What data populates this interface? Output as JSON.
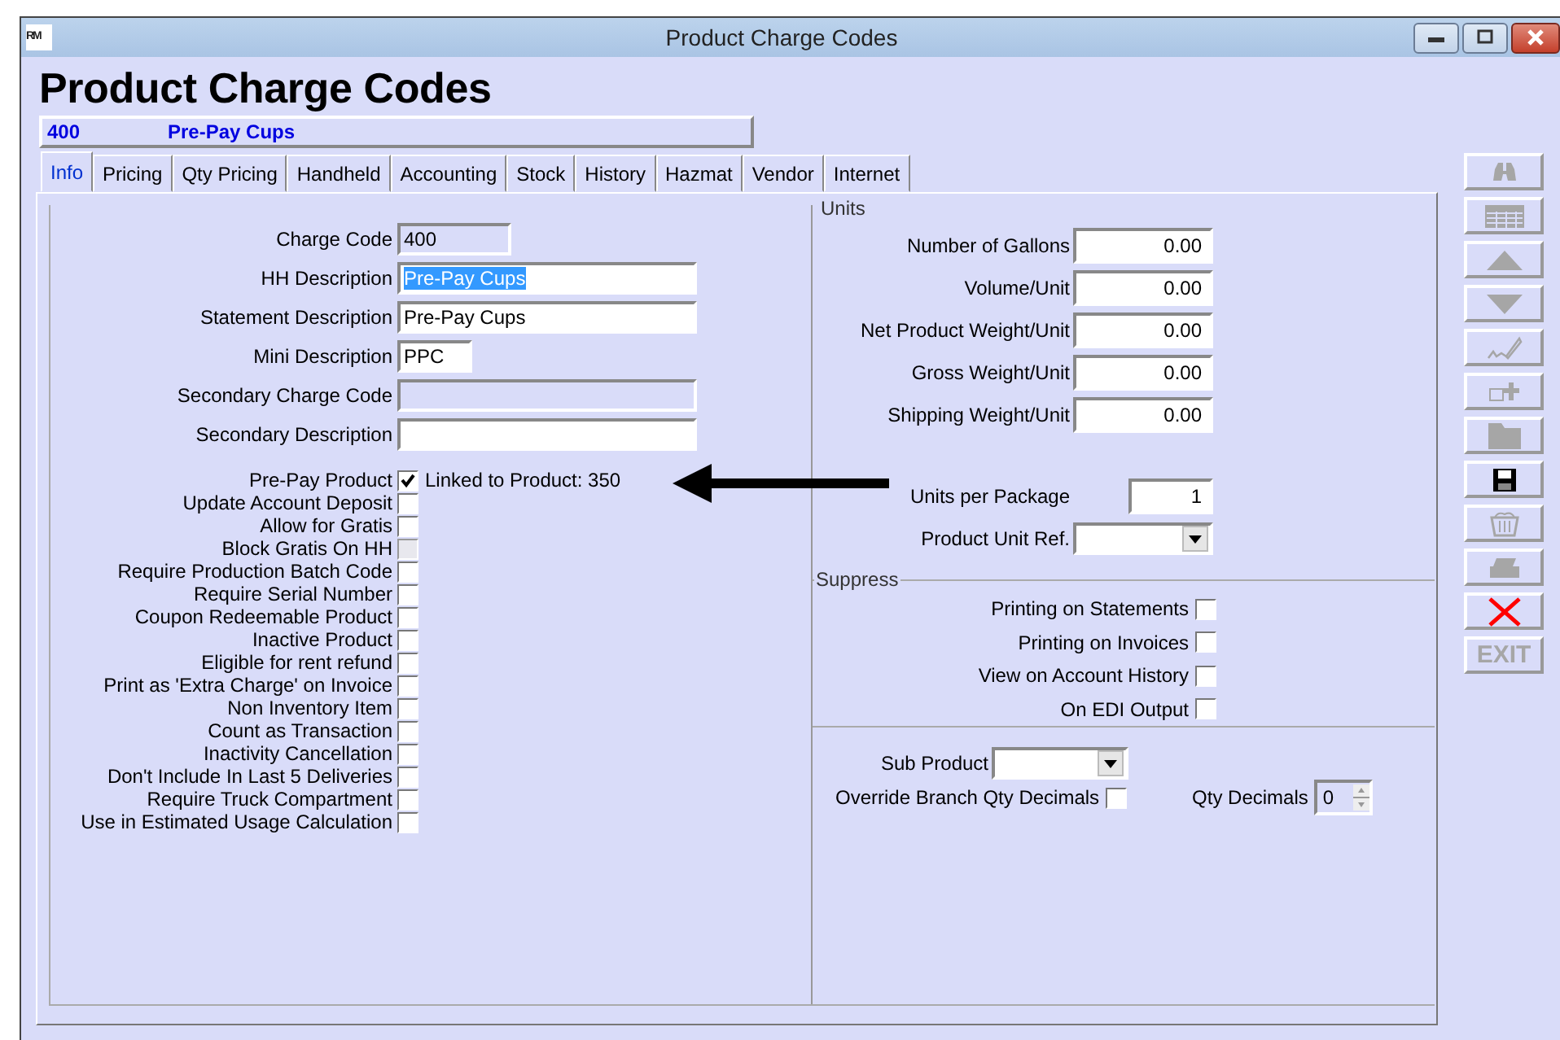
{
  "window": {
    "title": "Product Charge Codes",
    "logo": "RM"
  },
  "heading": "Product Charge Codes",
  "record": {
    "code": "400",
    "name": "Pre-Pay Cups"
  },
  "tabs": [
    {
      "label": "Info",
      "selected": true
    },
    {
      "label": "Pricing",
      "selected": false
    },
    {
      "label": "Qty Pricing",
      "selected": false
    },
    {
      "label": "Handheld",
      "selected": false
    },
    {
      "label": "Accounting",
      "selected": false
    },
    {
      "label": "Stock",
      "selected": false
    },
    {
      "label": "History",
      "selected": false
    },
    {
      "label": "Hazmat",
      "selected": false
    },
    {
      "label": "Vendor",
      "selected": false
    },
    {
      "label": "Internet",
      "selected": false
    }
  ],
  "fields": [
    {
      "label": "Charge Code",
      "value": "400",
      "disabled": true
    },
    {
      "label": "HH Description",
      "value": "Pre-Pay Cups",
      "disabled": false,
      "text_selected": true
    },
    {
      "label": "Statement Description",
      "value": "Pre-Pay Cups",
      "disabled": false
    },
    {
      "label": "Mini Description",
      "value": "PPC",
      "disabled": false
    },
    {
      "label": "Secondary Charge Code",
      "disabled": true
    },
    {
      "label": "Secondary Description",
      "disabled": false
    }
  ],
  "flags": [
    {
      "label": "Pre-Pay Product",
      "checked": true,
      "disabled": false,
      "note": "Linked to Product:  350"
    },
    {
      "label": "Update Account Deposit",
      "checked": false,
      "disabled": false
    },
    {
      "label": "Allow for Gratis",
      "checked": false,
      "disabled": false
    },
    {
      "label": "Block Gratis On HH",
      "checked": false,
      "disabled": true
    },
    {
      "label": "Require Production Batch Code",
      "checked": false,
      "disabled": false
    },
    {
      "label": "Require Serial Number",
      "checked": false,
      "disabled": false
    },
    {
      "label": "Coupon Redeemable Product",
      "checked": false,
      "disabled": false
    },
    {
      "label": "Inactive Product",
      "checked": false,
      "disabled": false
    },
    {
      "label": "Eligible for rent refund",
      "checked": false,
      "disabled": false
    },
    {
      "label": "Print as 'Extra Charge' on Invoice",
      "checked": false,
      "disabled": false
    },
    {
      "label": "Non Inventory Item",
      "checked": false,
      "disabled": false
    },
    {
      "label": "Count as Transaction",
      "checked": false,
      "disabled": false
    },
    {
      "label": "Inactivity Cancellation",
      "checked": false,
      "disabled": false
    },
    {
      "label": "Don't Include In Last 5 Deliveries",
      "checked": false,
      "disabled": false
    },
    {
      "label": "Require Truck Compartment",
      "checked": false,
      "disabled": false
    },
    {
      "label": "Use in Estimated Usage Calculation",
      "checked": false,
      "disabled": false
    }
  ],
  "units": {
    "legend": "Units",
    "measures": [
      {
        "label": "Number of Gallons",
        "value": "0.00"
      },
      {
        "label": "Volume/Unit",
        "value": "0.00"
      },
      {
        "label": "Net Product Weight/Unit",
        "value": "0.00"
      },
      {
        "label": "Gross Weight/Unit",
        "value": "0.00"
      },
      {
        "label": "Shipping Weight/Unit",
        "value": "0.00"
      }
    ],
    "units_per_package": {
      "label": "Units per Package",
      "value": "1"
    },
    "product_unit_ref": {
      "label": "Product Unit Ref."
    }
  },
  "suppress": {
    "legend": "Suppress",
    "options": [
      {
        "label": "Printing on Statements",
        "checked": false
      },
      {
        "label": "Printing on Invoices",
        "checked": false
      },
      {
        "label": "View on Account History",
        "checked": false
      },
      {
        "label": "On EDI Output",
        "checked": false
      }
    ]
  },
  "sub_product": {
    "label": "Sub Product"
  },
  "override": {
    "label": "Override Branch Qty Decimals",
    "checked": false
  },
  "qty_decimals": {
    "label": "Qty Decimals",
    "value": "0"
  },
  "toolbar": [
    {
      "kind": "find",
      "disabled": true
    },
    {
      "kind": "grid",
      "disabled": true
    },
    {
      "kind": "up",
      "disabled": true
    },
    {
      "kind": "down",
      "disabled": true
    },
    {
      "kind": "sign",
      "disabled": true
    },
    {
      "kind": "add",
      "disabled": true
    },
    {
      "kind": "folder",
      "disabled": true
    },
    {
      "kind": "save",
      "disabled": false
    },
    {
      "kind": "trash",
      "disabled": true
    },
    {
      "kind": "print",
      "disabled": true
    },
    {
      "kind": "cancel",
      "disabled": false
    },
    {
      "kind": "exit",
      "disabled": true,
      "label": "EXIT"
    }
  ]
}
